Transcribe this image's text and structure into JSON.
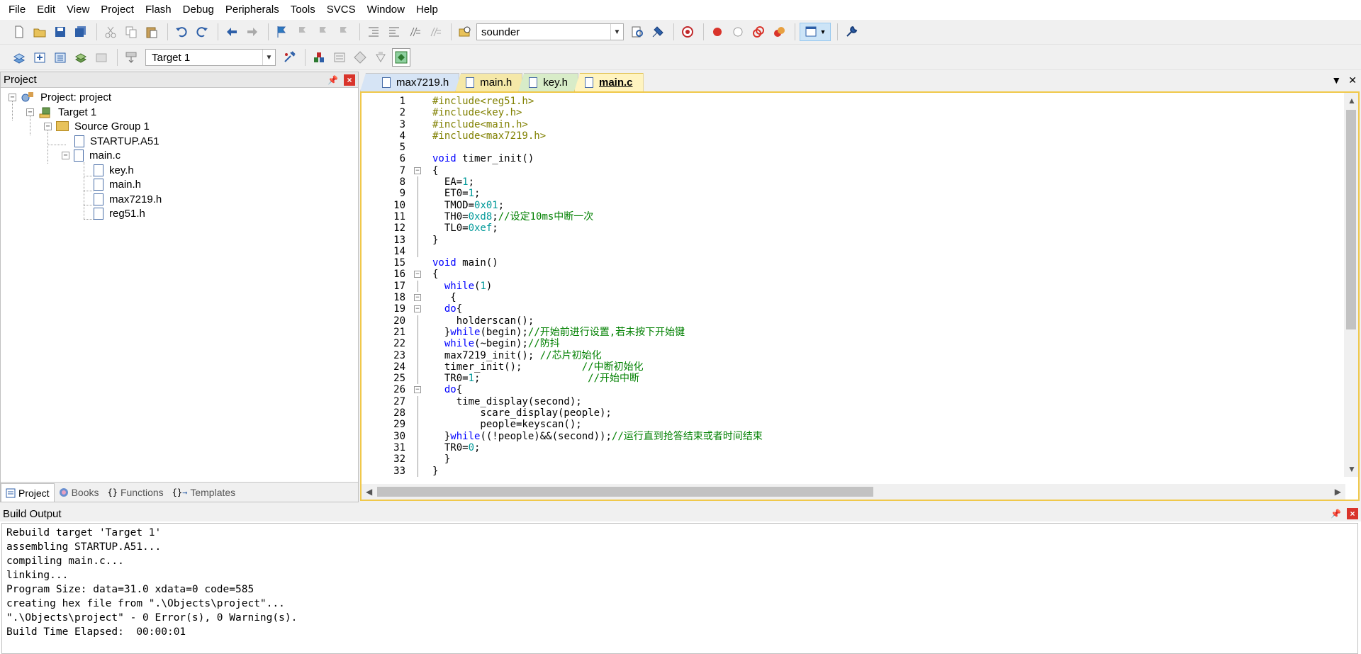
{
  "menu": [
    "File",
    "Edit",
    "View",
    "Project",
    "Flash",
    "Debug",
    "Peripherals",
    "Tools",
    "SVCS",
    "Window",
    "Help"
  ],
  "toolbar1": {
    "find_value": "sounder"
  },
  "toolbar2": {
    "target_value": "Target 1"
  },
  "project_panel": {
    "title": "Project",
    "tree": {
      "project": "Project: project",
      "target": "Target 1",
      "group": "Source Group 1",
      "startup": "STARTUP.A51",
      "main_c": "main.c",
      "children": [
        "key.h",
        "main.h",
        "max7219.h",
        "reg51.h"
      ]
    },
    "tabs": [
      "Project",
      "Books",
      "Functions",
      "Templates"
    ]
  },
  "editor": {
    "tabs": [
      "max7219.h",
      "main.h",
      "key.h",
      "main.c"
    ],
    "active_tab": "main.c",
    "lines": [
      "#include<reg51.h>",
      "#include<key.h>",
      "#include<main.h>",
      "#include<max7219.h>",
      "",
      "void timer_init()",
      "{",
      "  EA=1;",
      "  ET0=1;",
      "  TMOD=0x01;",
      "  TH0=0xd8;//设定10ms中断一次",
      "  TL0=0xef;",
      "}",
      "",
      "void main()",
      "{",
      "  while(1)",
      "   {",
      "  do{",
      "    holderscan();",
      "  }while(begin);//开始前进行设置,若未按下开始键",
      "  while(~begin);//防抖",
      "  max7219_init(); //芯片初始化",
      "  timer_init();          //中断初始化",
      "  TR0=1;                  //开始中断",
      "  do{",
      "    time_display(second);",
      "        scare_display(people);",
      "        people=keyscan();",
      "  }while((!people)&&(second));//运行直到抢答结束或者时间结束",
      "  TR0=0;",
      "  }",
      "}",
      ""
    ]
  },
  "build_output": {
    "title": "Build Output",
    "lines": [
      "Rebuild target 'Target 1'",
      "assembling STARTUP.A51...",
      "compiling main.c...",
      "linking...",
      "Program Size: data=31.0 xdata=0 code=585",
      "creating hex file from \".\\Objects\\project\"...",
      "\".\\Objects\\project\" - 0 Error(s), 0 Warning(s).",
      "Build Time Elapsed:  00:00:01"
    ]
  }
}
